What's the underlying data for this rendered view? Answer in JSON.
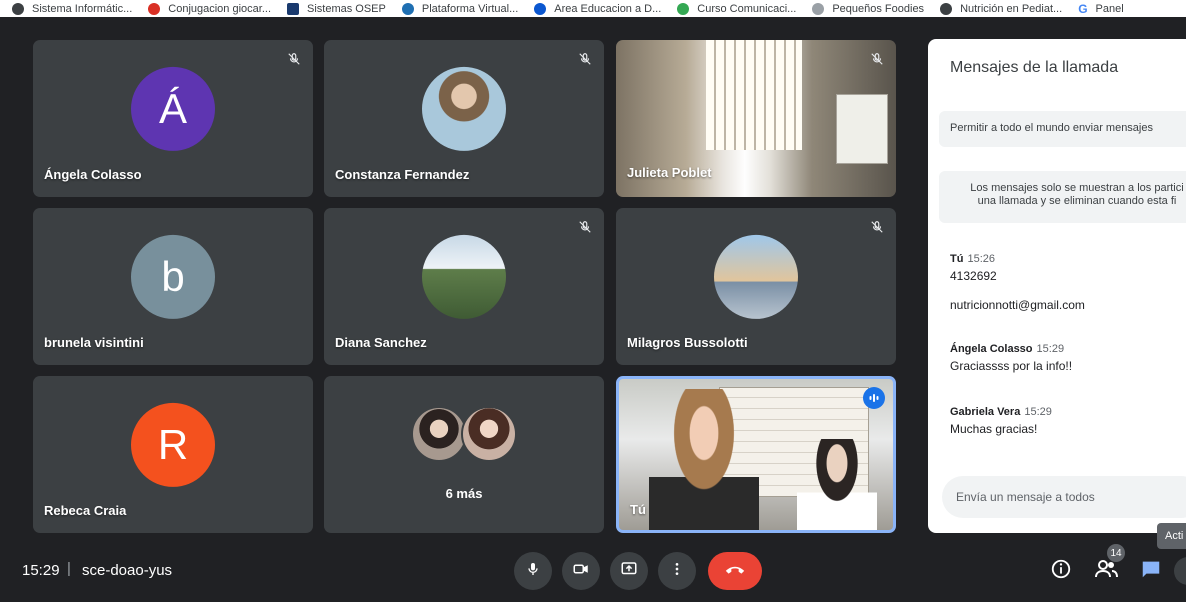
{
  "bookmarks": [
    {
      "label": "Sistema Informátic...",
      "icon": "globe-icon",
      "color": "#3c4043"
    },
    {
      "label": "Conjugacion giocar...",
      "icon": "swirl-icon",
      "color": "#d93025"
    },
    {
      "label": "Sistemas OSEP",
      "icon": "osep-icon",
      "color": "#1a3a6e"
    },
    {
      "label": "Plataforma Virtual...",
      "icon": "drop-icon",
      "color": "#1f6fb2"
    },
    {
      "label": "Area Educacion a D...",
      "icon": "a-logo-icon",
      "color": "#0b57d0"
    },
    {
      "label": "Curso Comunicaci...",
      "icon": "leaf-icon",
      "color": "#34a853"
    },
    {
      "label": "Pequeños Foodies",
      "icon": "spiral-icon",
      "color": "#9aa0a6"
    },
    {
      "label": "Nutrición en Pediat...",
      "icon": "globe-icon",
      "color": "#3c4043"
    },
    {
      "label": "Panel",
      "icon": "google-g-icon",
      "color": "#4285f4"
    }
  ],
  "participants": [
    {
      "name": "Ángela Colasso",
      "initial": "Á",
      "color": "#5e35b1",
      "muted": true
    },
    {
      "name": "Constanza Fernandez",
      "muted": true
    },
    {
      "name": "Julieta Poblet",
      "muted": true
    },
    {
      "name": "brunela visintini",
      "initial": "b",
      "color": "#78909c",
      "muted": false
    },
    {
      "name": "Diana Sanchez",
      "muted": true
    },
    {
      "name": "Milagros Bussolotti",
      "muted": true
    },
    {
      "name": "Rebeca Craia",
      "initial": "R",
      "color": "#f4511e",
      "muted": false
    },
    {
      "more_label": "6 más"
    },
    {
      "name": "Tú",
      "speaking": true
    }
  ],
  "chat": {
    "title": "Mensajes de la llamada",
    "toggle_label": "Permitir a todo el mundo enviar mensajes",
    "info_line1": "Los mensajes solo se muestran a los partici",
    "info_line2": "una llamada y se eliminan cuando esta fi",
    "messages": [
      {
        "sender": "Tú",
        "time": "15:26",
        "text": "4132692",
        "extra": "nutricionnotti@gmail.com"
      },
      {
        "sender": "Ángela Colasso",
        "time": "15:29",
        "text": "Graciassss por la info!!"
      },
      {
        "sender": "Gabriela Vera",
        "time": "15:29",
        "text": "Muchas gracias!"
      }
    ],
    "input_placeholder": "Envía un mensaje a todos"
  },
  "bottombar": {
    "time": "15:29",
    "separator": "|",
    "meeting_code": "sce-doao-yus",
    "participant_count": "14",
    "tooltip": "Acti"
  },
  "colors": {
    "background": "#202124",
    "tile": "#3c4043",
    "end_call": "#ea4335",
    "accent": "#1a73e8"
  }
}
